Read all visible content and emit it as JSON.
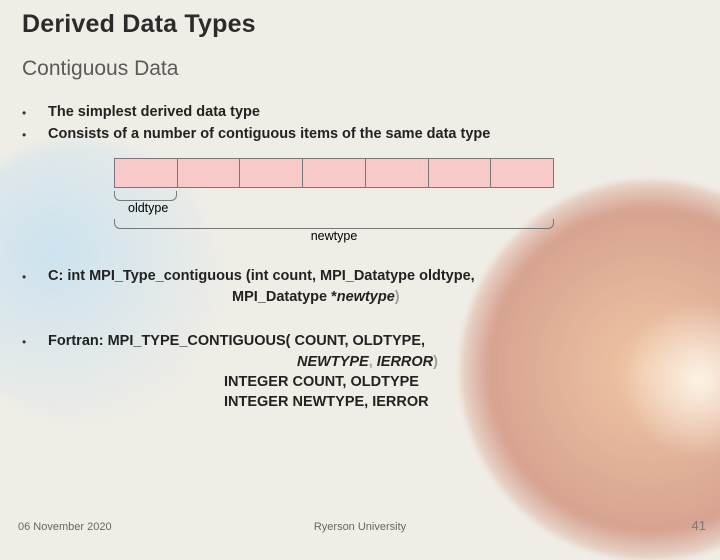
{
  "title": "Derived Data Types",
  "subtitle": "Contiguous Data",
  "bullets": [
    "The simplest derived data type",
    "Consists of a number of contiguous items of the same data type"
  ],
  "diagram": {
    "cell_count": 7,
    "oldtype_label": "oldtype",
    "newtype_label": "newtype"
  },
  "c_sig": {
    "prefix": "C:  int MPI_Type_contiguous (int count,  MPI_Datatype oldtype,",
    "line2_a": "MPI_Datatype  *",
    "line2_b": "newtype",
    "line2_c": ")"
  },
  "fortran_sig": {
    "prefix": "Fortran:  MPI_TYPE_CONTIGUOUS( COUNT, OLDTYPE,",
    "line2_a": "NEWTYPE",
    "line2_b": ", ",
    "line2_c": "IERROR",
    "line2_d": ")",
    "decl1": "INTEGER COUNT, OLDTYPE",
    "decl2": "INTEGER NEWTYPE, IERROR"
  },
  "footer": {
    "date": "06 November 2020",
    "org": "Ryerson University",
    "page": "41"
  }
}
